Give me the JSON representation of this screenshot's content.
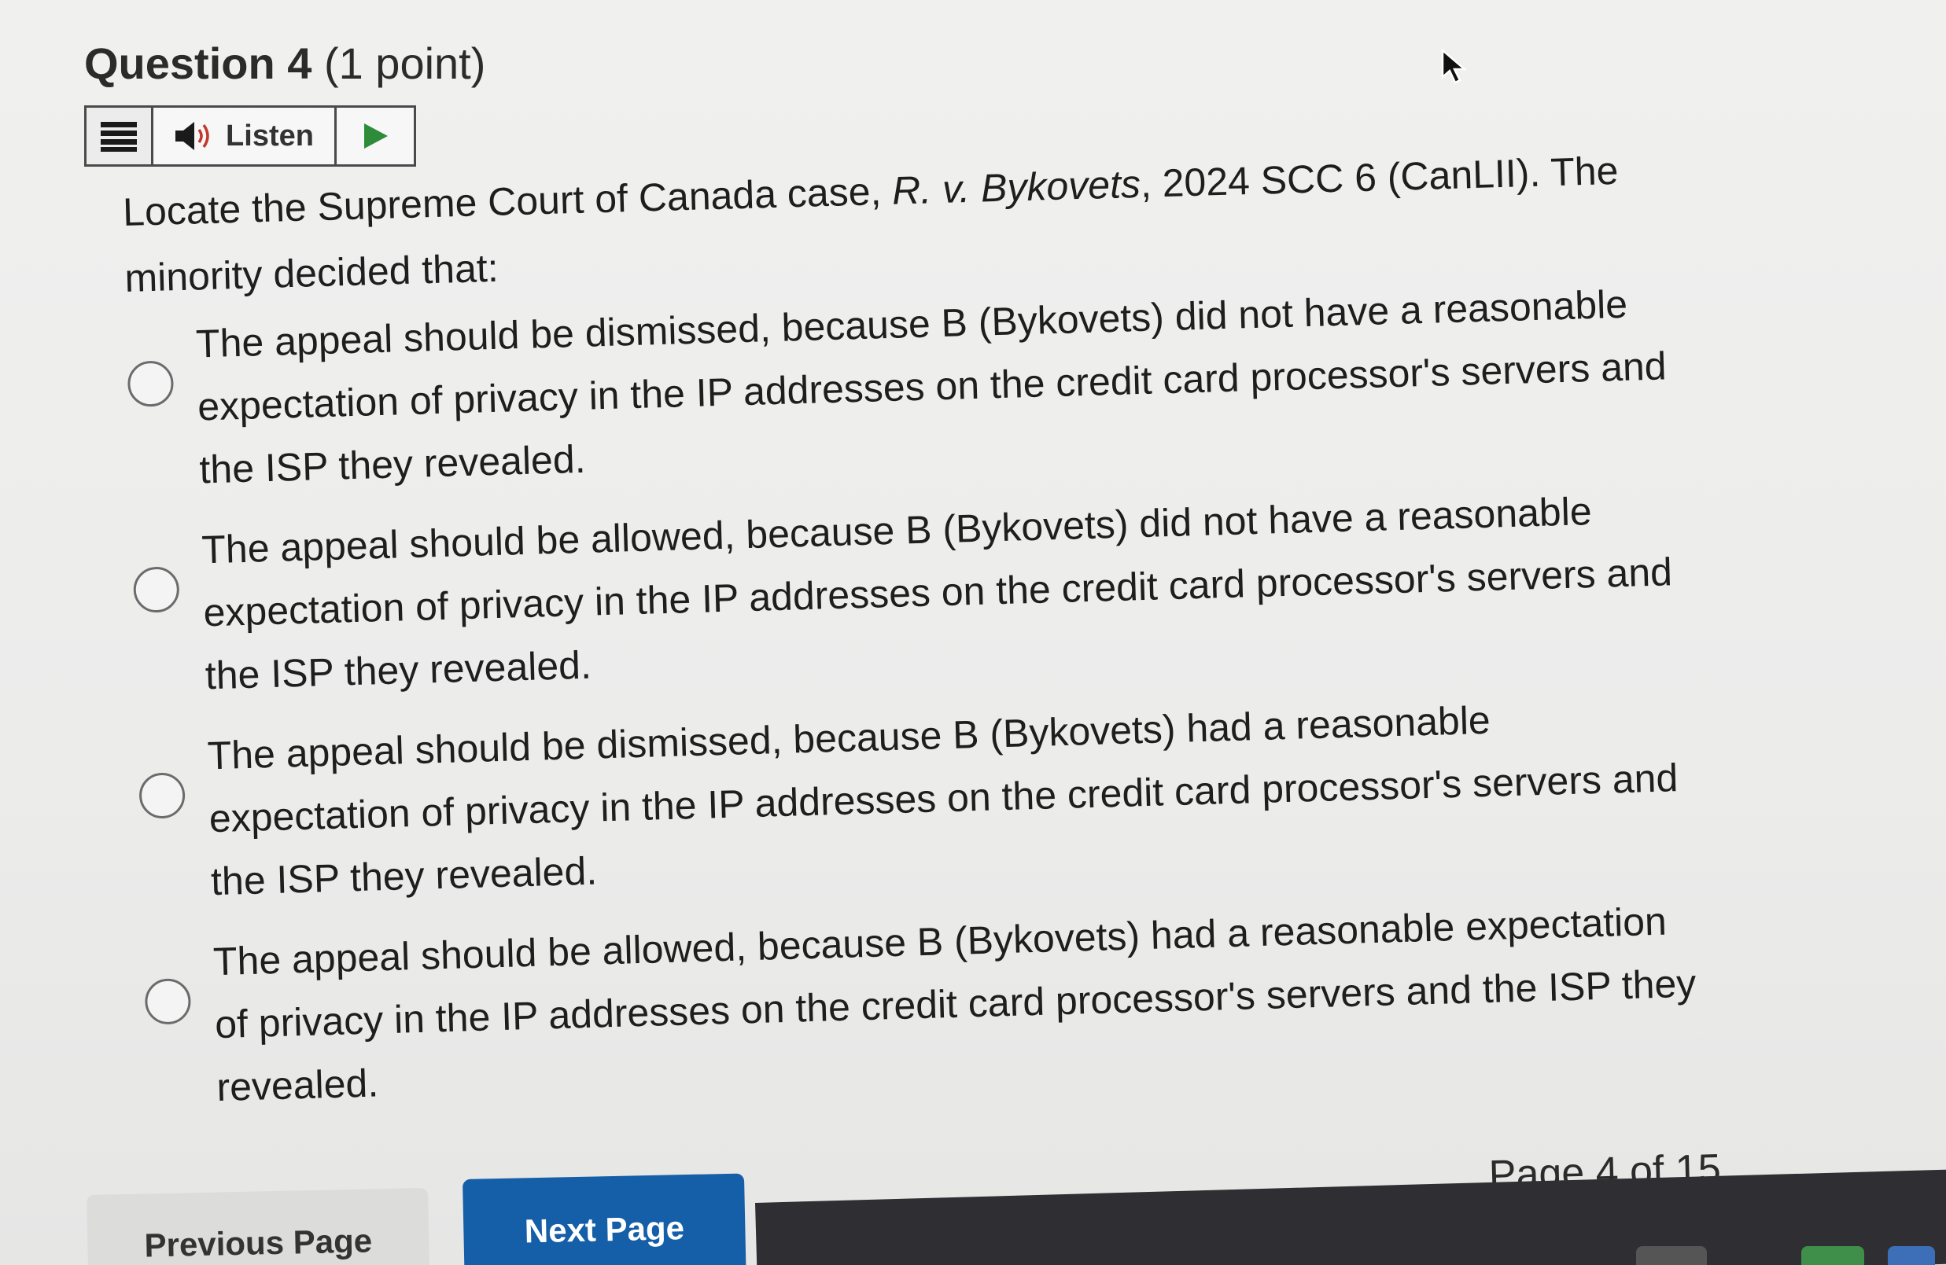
{
  "question": {
    "title": "Question 4",
    "points": "(1 point)"
  },
  "listen_toolbar": {
    "menu_icon": "hamburger-menu-icon",
    "speaker_icon": "speaker-icon",
    "listen_label": "Listen",
    "play_icon": "play-icon"
  },
  "prompt": {
    "text_before": "Locate the Supreme Court of Canada case, ",
    "case_name": "R. v. Bykovets",
    "text_after": ", 2024 SCC 6 (CanLII). The minority decided that:"
  },
  "options": [
    {
      "label": "The appeal should be dismissed, because B (Bykovets) did not have a reasonable expectation of privacy in the IP addresses on the credit card processor's servers and the ISP they revealed.",
      "selected": false
    },
    {
      "label": "The appeal should be allowed, because B (Bykovets) did not have a reasonable expectation of privacy in the IP addresses on the credit card processor's servers and the ISP they revealed.",
      "selected": false
    },
    {
      "label": "The appeal should be dismissed, because B (Bykovets) had a reasonable expectation of privacy in the IP addresses on the credit card processor's servers and the ISP they revealed.",
      "selected": false
    },
    {
      "label": "The appeal should be allowed, because B (Bykovets) had a reasonable expectation of privacy in the IP addresses on the credit card processor's servers and the ISP they revealed.",
      "selected": false
    }
  ],
  "pagination": {
    "indicator": "Page 4 of 15",
    "previous_label": "Previous Page",
    "next_label": "Next Page"
  },
  "colors": {
    "next_button": "#155ea8",
    "previous_button": "#dcdcdb",
    "background": "#ececeb"
  }
}
